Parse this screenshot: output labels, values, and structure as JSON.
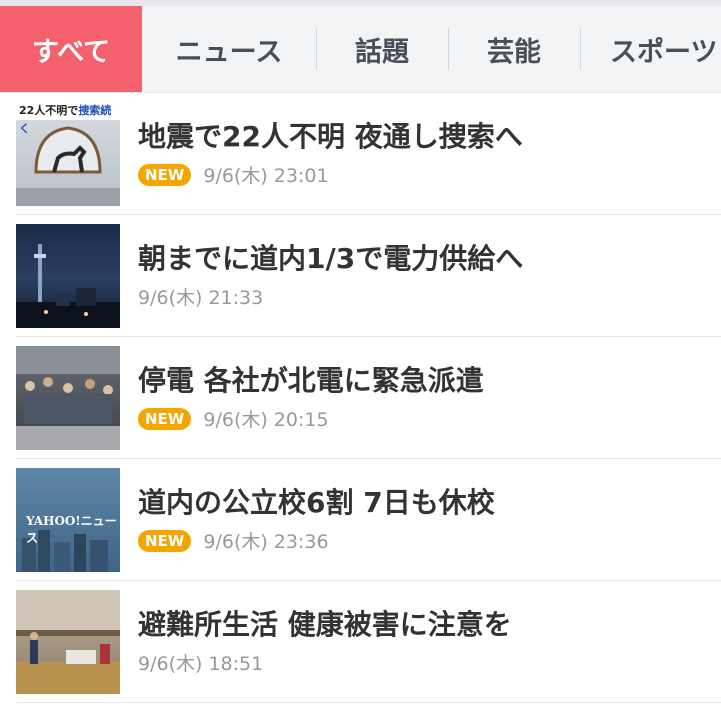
{
  "tabs": [
    {
      "label": "すべて",
      "active": true
    },
    {
      "label": "ニュース"
    },
    {
      "label": "話題"
    },
    {
      "label": "芸能"
    },
    {
      "label": "スポーツ"
    }
  ],
  "colors": {
    "active_tab": "#f4616c",
    "new_badge": "#f4a600"
  },
  "articles": [
    {
      "title": "地震で22人不明 夜通し捜索へ",
      "badge": "NEW",
      "time": "9/6(木) 23:01",
      "thumb_caption_a": "22人不明で",
      "thumb_caption_b": "捜索続く"
    },
    {
      "title": "朝までに道内1/3で電力供給へ",
      "time": "9/6(木) 21:33"
    },
    {
      "title": "停電 各社が北電に緊急派遣",
      "badge": "NEW",
      "time": "9/6(木) 20:15"
    },
    {
      "title": "道内の公立校6割 7日も休校",
      "badge": "NEW",
      "time": "9/6(木) 23:36",
      "thumb_logo": "YAHOO!ニュース"
    },
    {
      "title": "避難所生活 健康被害に注意を",
      "time": "9/6(木) 18:51"
    }
  ]
}
